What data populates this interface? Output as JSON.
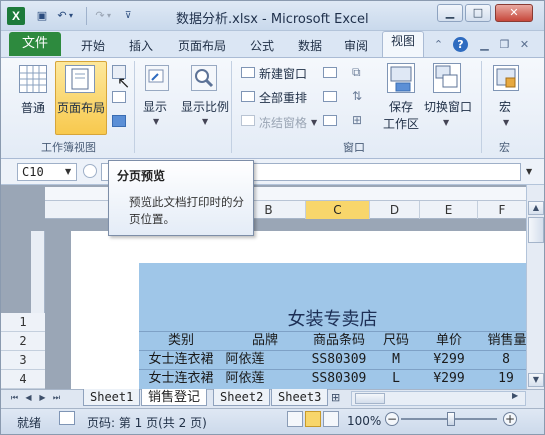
{
  "window": {
    "title": "数据分析.xlsx - Microsoft Excel",
    "app_icon": "excel-icon"
  },
  "tabs": {
    "file": "文件",
    "items": [
      "开始",
      "插入",
      "页面布局",
      "公式",
      "数据",
      "审阅"
    ],
    "active": "视图"
  },
  "ribbon": {
    "workbook_views": {
      "normal": "普通",
      "page_layout": "页面布局",
      "group_label": "工作簿视图"
    },
    "show": {
      "label": "显示"
    },
    "zoom": {
      "label": "显示比例"
    },
    "window_group": {
      "new_window": "新建窗口",
      "arrange_all": "全部重排",
      "freeze_panes": "冻结窗格",
      "save_workspace": "保存工作区",
      "save_line1": "保存",
      "save_line2": "工作区",
      "switch_windows": "切换窗口",
      "group_label": "窗口"
    },
    "macros": {
      "label": "宏",
      "group_label": "宏"
    }
  },
  "formula_bar": {
    "name_box": "C10"
  },
  "tooltip": {
    "title": "分页预览",
    "body_line1": "预览此文档打印时的分",
    "body_line2": "页位置。"
  },
  "sheet": {
    "columns": [
      "B",
      "C",
      "D",
      "E",
      "F"
    ],
    "selected_column": "C",
    "rows": [
      "1",
      "2",
      "3",
      "4"
    ],
    "store_title": "女装专卖店",
    "headers": [
      "类别",
      "品牌",
      "商品条码",
      "尺码",
      "单价",
      "销售量"
    ],
    "data": [
      [
        "女士连衣裙",
        "阿依莲",
        "SS80309",
        "M",
        "¥299",
        "8"
      ],
      [
        "女士连衣裙",
        "阿依莲",
        "SS80309",
        "L",
        "¥299",
        "19"
      ]
    ]
  },
  "sheet_tabs": [
    "Sheet1",
    "销售登记",
    "Sheet2",
    "Sheet3"
  ],
  "active_sheet": "销售登记",
  "status": {
    "ready": "就绪",
    "page_info": "页码: 第 1 页(共 2 页)",
    "zoom": "100%",
    "zoom_value": 1.0
  },
  "colors": {
    "file_tab": "#2d8a3e",
    "band": "#9fc6e8",
    "selected_col": "#f8d66b"
  }
}
